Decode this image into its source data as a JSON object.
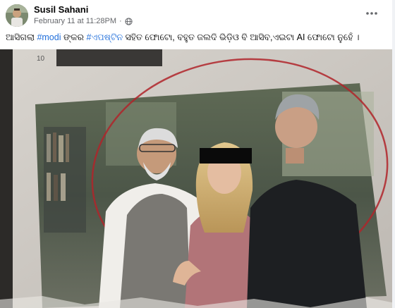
{
  "post": {
    "author": "Susil Sahani",
    "timestamp": "February 11 at 11:28PM",
    "separator": "·",
    "privacy_icon": "globe-icon",
    "more_icon": "more-horizontal-icon",
    "caption": {
      "part1": "ଆସିଗଲା ",
      "hashtag1": "#modi",
      "part2": " ଙ୍କର ",
      "hashtag2": "#ଏପଷ୍ଟିନ",
      "part3": " ସହିତ ଫୋଟୋ, ବହୁତ ଜଲଦି ଭିଡ଼ିଓ ବି ଆସିବ,ଏଇଟା AI ଫୋଟୋ ନୁହେଁ ।"
    },
    "photo": {
      "page_number": "10"
    }
  }
}
